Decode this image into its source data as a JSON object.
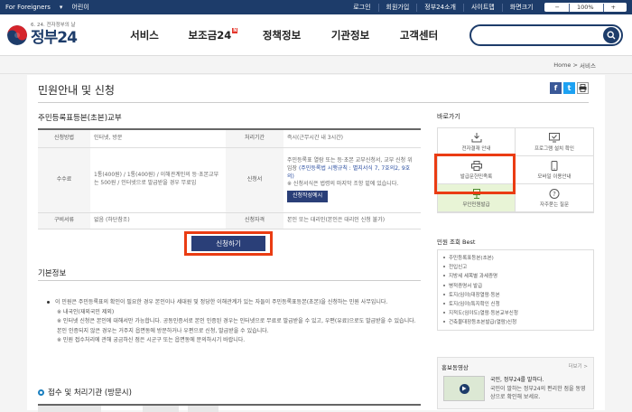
{
  "topbar": {
    "foreigners": "For Foreigners",
    "kids": "어린이",
    "links": [
      "로그인",
      "회원가입",
      "정부24소개",
      "사이트맵",
      "화면크기"
    ],
    "zoom": "100%",
    "zoom_minus": "−",
    "zoom_plus": "+"
  },
  "logo": {
    "small": "6. 24. 전자정부의 날",
    "big": "정부24"
  },
  "nav": {
    "items": [
      "서비스",
      "보조금24",
      "정책정보",
      "기관정보",
      "고객센터"
    ],
    "badge": "N"
  },
  "breadcrumb": {
    "home": "Home",
    "sep": ">",
    "current": "서비스"
  },
  "page": {
    "title": "민원안내 및 신청"
  },
  "service": {
    "title": "주민등록표등본(초본)교부",
    "rows": {
      "method_label": "신청방법",
      "method": "인터넷, 방문",
      "period_label": "처리기간",
      "period": "즉시(근무시간 내 3시간)",
      "fee_label": "수수료",
      "fee": "1통(400원) / 1통(400원) / 이해관계인의 등·초본교부는 500원 / 인터넷으로 발급받을 경우 무료임",
      "form_label": "신청서",
      "form": "주민등록표 열람 또는 등·초본 교부신청서, 교부 신청 위임장",
      "form_ref": "(주민등록법 시행규칙 : 별지서식 7, 7호의2, 9호의)",
      "form_note": "※ 신청서식은 법령의 마지막 조항 밑에 있습니다.",
      "form_btn": "신청작성예시",
      "docs_label": "구비서류",
      "docs": "없음 (하단참조)",
      "qual_label": "신청자격",
      "qual": "본인 또는 대리인(본인은 대리인 신청 불가)"
    },
    "apply_button": "신청하기"
  },
  "basic": {
    "title": "기본정보",
    "notes": [
      "이 민원은 주민등록표의 확인이 필요한 경우 본인이나 세대원 및 정당한 이해관계가 있는 자들이 주민등록표등본(초본)을 신청하는 민원 사무입니다.",
      "※ 내국인(재외국민 제외)",
      "※ 인터넷 신청은 본인에 대해서만 가능합니다. 공동인증서로 본인 인증된 경우는 인터넷으로 무료로 발급받을 수 있고, 우편(유료)으로도 발급받을 수 있습니다. 본인 인증되지 않은 경우는 거주지 읍면동에 방문하거나 우편으로 신청, 발급받을 수 있습니다.",
      "※ 민원 접수처리에 관해 궁금하신 점은 시군구 또는 읍면동에 문의하시기 바랍니다."
    ],
    "procedure": "접수 및 처리기관 (방문시)"
  },
  "sidebar": {
    "title": "바로가기",
    "shortcuts": [
      "전자결재 안내",
      "프로그램 설치 확인",
      "발급문헌민족룩",
      "모바일 이용안내",
      "무인민원발급",
      "자주묻는 질문"
    ],
    "best_title": "민원 조회 Best",
    "best": [
      "주민등록표등본(초본)",
      "전입신고",
      "지방세 세목별 과세증명",
      "병적증명서 발급",
      "토지(임야)대장열람·등본",
      "토지(임야)특지확인 신청",
      "지적도(임야도)열람·등본교부신청",
      "건축물대장등초본발급(열람)신청"
    ],
    "video_title": "홍보동영상",
    "video_more": "더보기 >",
    "video_desc1": "국민, 정부24를 말하다.",
    "video_desc2": "국민이 말하는 정부24의 편리한 점을 동영상으로 확인해 보세요."
  }
}
